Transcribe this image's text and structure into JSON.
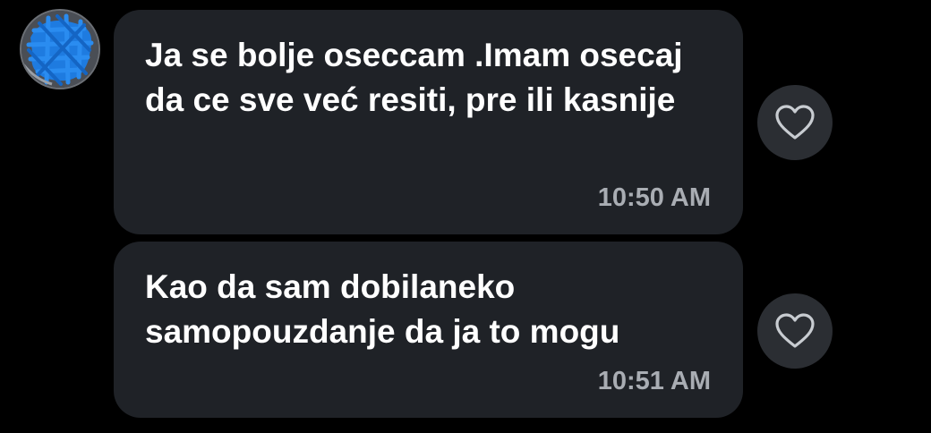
{
  "conversation": {
    "avatar_icon": "redacted-avatar-icon",
    "messages": [
      {
        "text": "Ja se bolje oseccam .Imam osecaj da ce sve već resiti, pre ili kasnije",
        "time": "10:50 AM",
        "reaction_icon": "heart-outline-icon"
      },
      {
        "text": "Kao da sam dobilaneko samopouzdanje da ja to mogu",
        "time": "10:51 AM",
        "reaction_icon": "heart-outline-icon"
      }
    ]
  },
  "colors": {
    "background": "#000000",
    "bubble": "#1f2227",
    "text": "#ffffff",
    "timestamp": "#a9adb3",
    "reaction_button": "#2b2e33",
    "avatar_scribble": "#1e7be0"
  }
}
